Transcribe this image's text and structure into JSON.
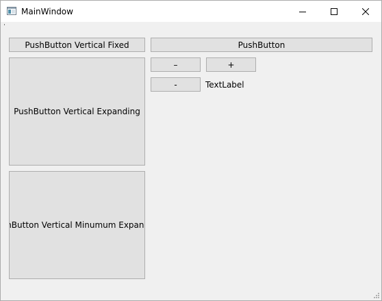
{
  "window": {
    "title": "MainWindow",
    "icon": "app-window-icon",
    "controls": [
      "minimize-icon",
      "maximize-icon",
      "close-icon"
    ]
  },
  "buttons": {
    "vertical_fixed": "PushButton Vertical Fixed",
    "vertical_expanding": "PushButton Vertical Expanding",
    "vertical_min_expanding": "PushButton Vertical Minumum Expanding",
    "pushbutton": "PushButton",
    "minus_1": "–",
    "plus": "+",
    "minus_2": "-"
  },
  "text_label": "TextLabel",
  "colors": {
    "window_bg": "#f0f0f0",
    "button_bg": "#e1e1e1",
    "button_border": "#adadad",
    "titlebar_bg": "#ffffff"
  }
}
